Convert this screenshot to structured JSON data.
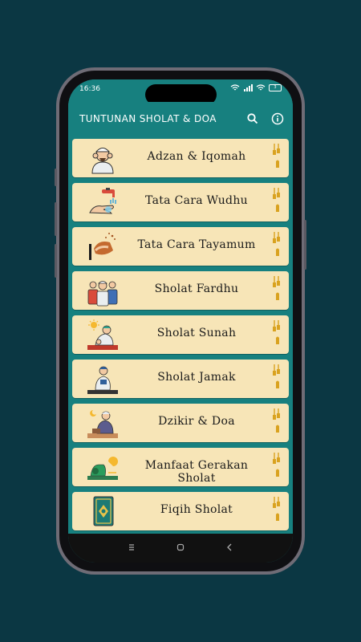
{
  "status_bar": {
    "time": "16:36",
    "battery_level": "3"
  },
  "app_bar": {
    "title": "TUNTUNAN SHOLAT & DOA",
    "search_icon": "search-icon",
    "info_icon": "info-icon"
  },
  "menu": {
    "items": [
      {
        "label": "Adzan & Iqomah",
        "icon": "muadzin-icon"
      },
      {
        "label": "Tata Cara Wudhu",
        "icon": "wudhu-icon"
      },
      {
        "label": "Tata Cara Tayamum",
        "icon": "tayamum-icon"
      },
      {
        "label": "Sholat Fardhu",
        "icon": "jamaah-icon"
      },
      {
        "label": "Sholat Sunah",
        "icon": "sunah-icon"
      },
      {
        "label": "Sholat Jamak",
        "icon": "jamak-icon"
      },
      {
        "label": "Dzikir & Doa",
        "icon": "dzikir-icon"
      },
      {
        "label": "Manfaat Gerakan Sholat",
        "icon": "gerakan-icon"
      },
      {
        "label": "Fiqih Sholat",
        "icon": "book-icon"
      }
    ]
  },
  "colors": {
    "background": "#0b3743",
    "primary": "#17807f",
    "card": "#f7e5b7",
    "ornament": "#d9a21f"
  }
}
